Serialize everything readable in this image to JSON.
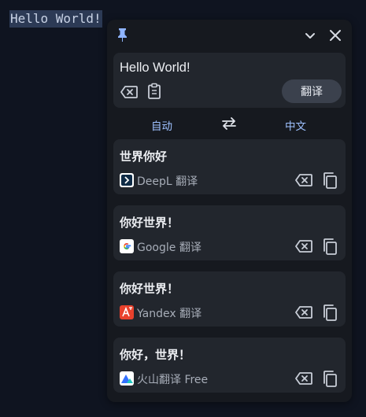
{
  "background": {
    "selected_text": "Hello World!"
  },
  "popup": {
    "input_text": "Hello World!",
    "translate_label": "翻译",
    "source_lang": "自动",
    "target_lang": "中文",
    "results": [
      {
        "text": "世界你好",
        "service": "DeepL 翻译",
        "logo": "deepl-icon"
      },
      {
        "text": "你好世界！",
        "service": "Google 翻译",
        "logo": "google-icon"
      },
      {
        "text": "你好世界！",
        "service": "Yandex 翻译",
        "logo": "yandex-icon"
      },
      {
        "text": "你好，世界！",
        "service": "火山翻译 Free",
        "logo": "volcano-icon"
      }
    ]
  },
  "colors": {
    "page_bg": "#0f1420",
    "panel_bg": "#16191f",
    "card_bg": "#22262d",
    "accent": "#9ec1ff"
  }
}
